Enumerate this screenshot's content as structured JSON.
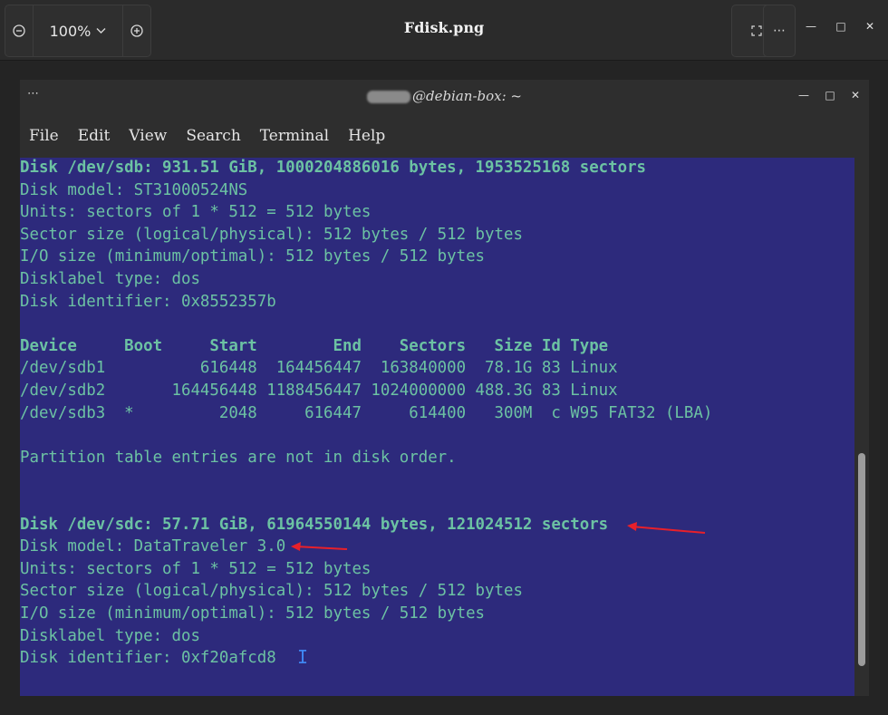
{
  "viewer": {
    "zoom_value": "100%",
    "title": "Fdisk.png",
    "icons": {
      "zoom_out": "zoom-out-icon",
      "zoom_in": "zoom-in-icon",
      "fullscreen": "fullscreen-icon",
      "menu": "more-options-icon",
      "minimize": "minimize-icon",
      "maximize": "maximize-icon",
      "close": "close-icon"
    }
  },
  "terminal": {
    "title_suffix": "@debian-box: ~",
    "menu": [
      "File",
      "Edit",
      "View",
      "Search",
      "Terminal",
      "Help"
    ],
    "lines": [
      "Disk /dev/sdb: 931.51 GiB, 1000204886016 bytes, 1953525168 sectors",
      "Disk model: ST31000524NS",
      "Units: sectors of 1 * 512 = 512 bytes",
      "Sector size (logical/physical): 512 bytes / 512 bytes",
      "I/O size (minimum/optimal): 512 bytes / 512 bytes",
      "Disklabel type: dos",
      "Disk identifier: 0x8552357b",
      "",
      "Device     Boot     Start        End    Sectors   Size Id Type",
      "/dev/sdb1          616448  164456447  163840000  78.1G 83 Linux",
      "/dev/sdb2       164456448 1188456447 1024000000 488.3G 83 Linux",
      "/dev/sdb3  *         2048     616447     614400   300M  c W95 FAT32 (LBA)",
      "",
      "Partition table entries are not in disk order.",
      "",
      "",
      "Disk /dev/sdc: 57.71 GiB, 61964550144 bytes, 121024512 sectors",
      "Disk model: DataTraveler 3.0",
      "Units: sectors of 1 * 512 = 512 bytes",
      "Sector size (logical/physical): 512 bytes / 512 bytes",
      "I/O size (minimum/optimal): 512 bytes / 512 bytes",
      "Disklabel type: dos",
      "Disk identifier: 0xf20afcd8"
    ],
    "bold_lines": [
      0,
      8,
      16
    ],
    "colors": {
      "background": "#2d2a7c",
      "text": "#6cc2a3",
      "annotation_arrow": "#e8202a",
      "cursor": "#3f86f2"
    }
  }
}
